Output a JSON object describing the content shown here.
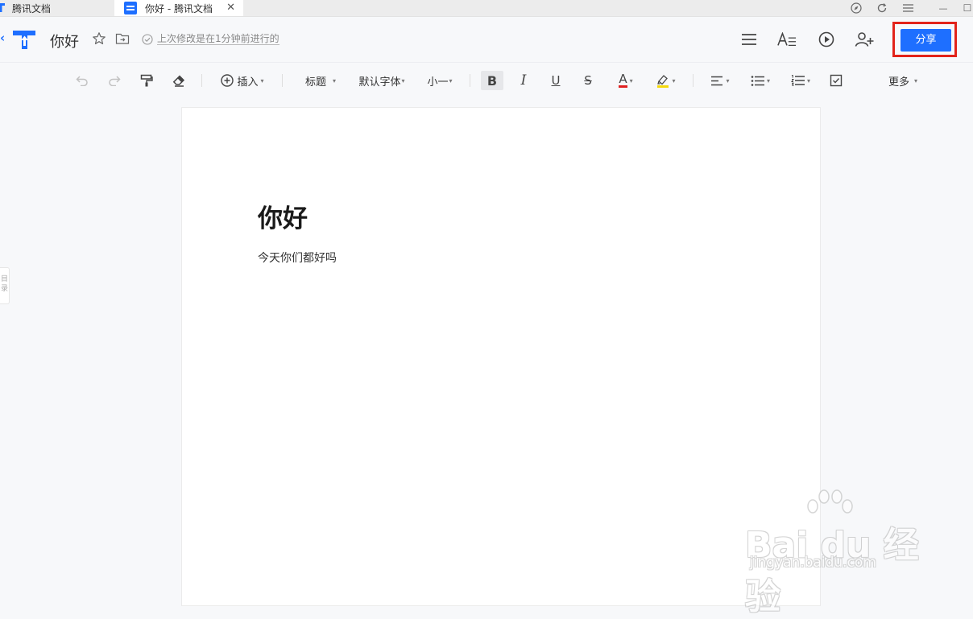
{
  "tabs": {
    "home_label": "腾讯文档",
    "active_label": "你好 - 腾讯文档",
    "close_glyph": "✕"
  },
  "window_controls": {
    "minimize_glyph": "—",
    "maximize_glyph": "☐"
  },
  "header": {
    "back_glyph": "‹",
    "doc_title": "你好",
    "save_status": "上次修改是在1分钟前进行的",
    "share_label": "分享",
    "icons": [
      "menu-icon",
      "font-style-icon",
      "play-icon",
      "add-collaborator-icon"
    ]
  },
  "toolbar": {
    "insert_label": "插入",
    "heading_label": "标题",
    "font_family_label": "默认字体",
    "font_size_label": "小一",
    "bold_glyph": "B",
    "italic_glyph": "I",
    "underline_glyph": "U",
    "strike_glyph": "S",
    "font_color_glyph": "A",
    "more_label": "更多",
    "caret": "▾",
    "font_color": "#e02020",
    "highlight_color": "#f5d90a"
  },
  "sidebar": {
    "outline_tab_label": "目录"
  },
  "document": {
    "heading": "你好",
    "body": "今天你们都好吗"
  },
  "watermark": {
    "main": "Bai du 经验",
    "url": "jingyan.baidu.com"
  },
  "colors": {
    "accent": "#1e6fff",
    "highlight_box": "#e2231a"
  }
}
